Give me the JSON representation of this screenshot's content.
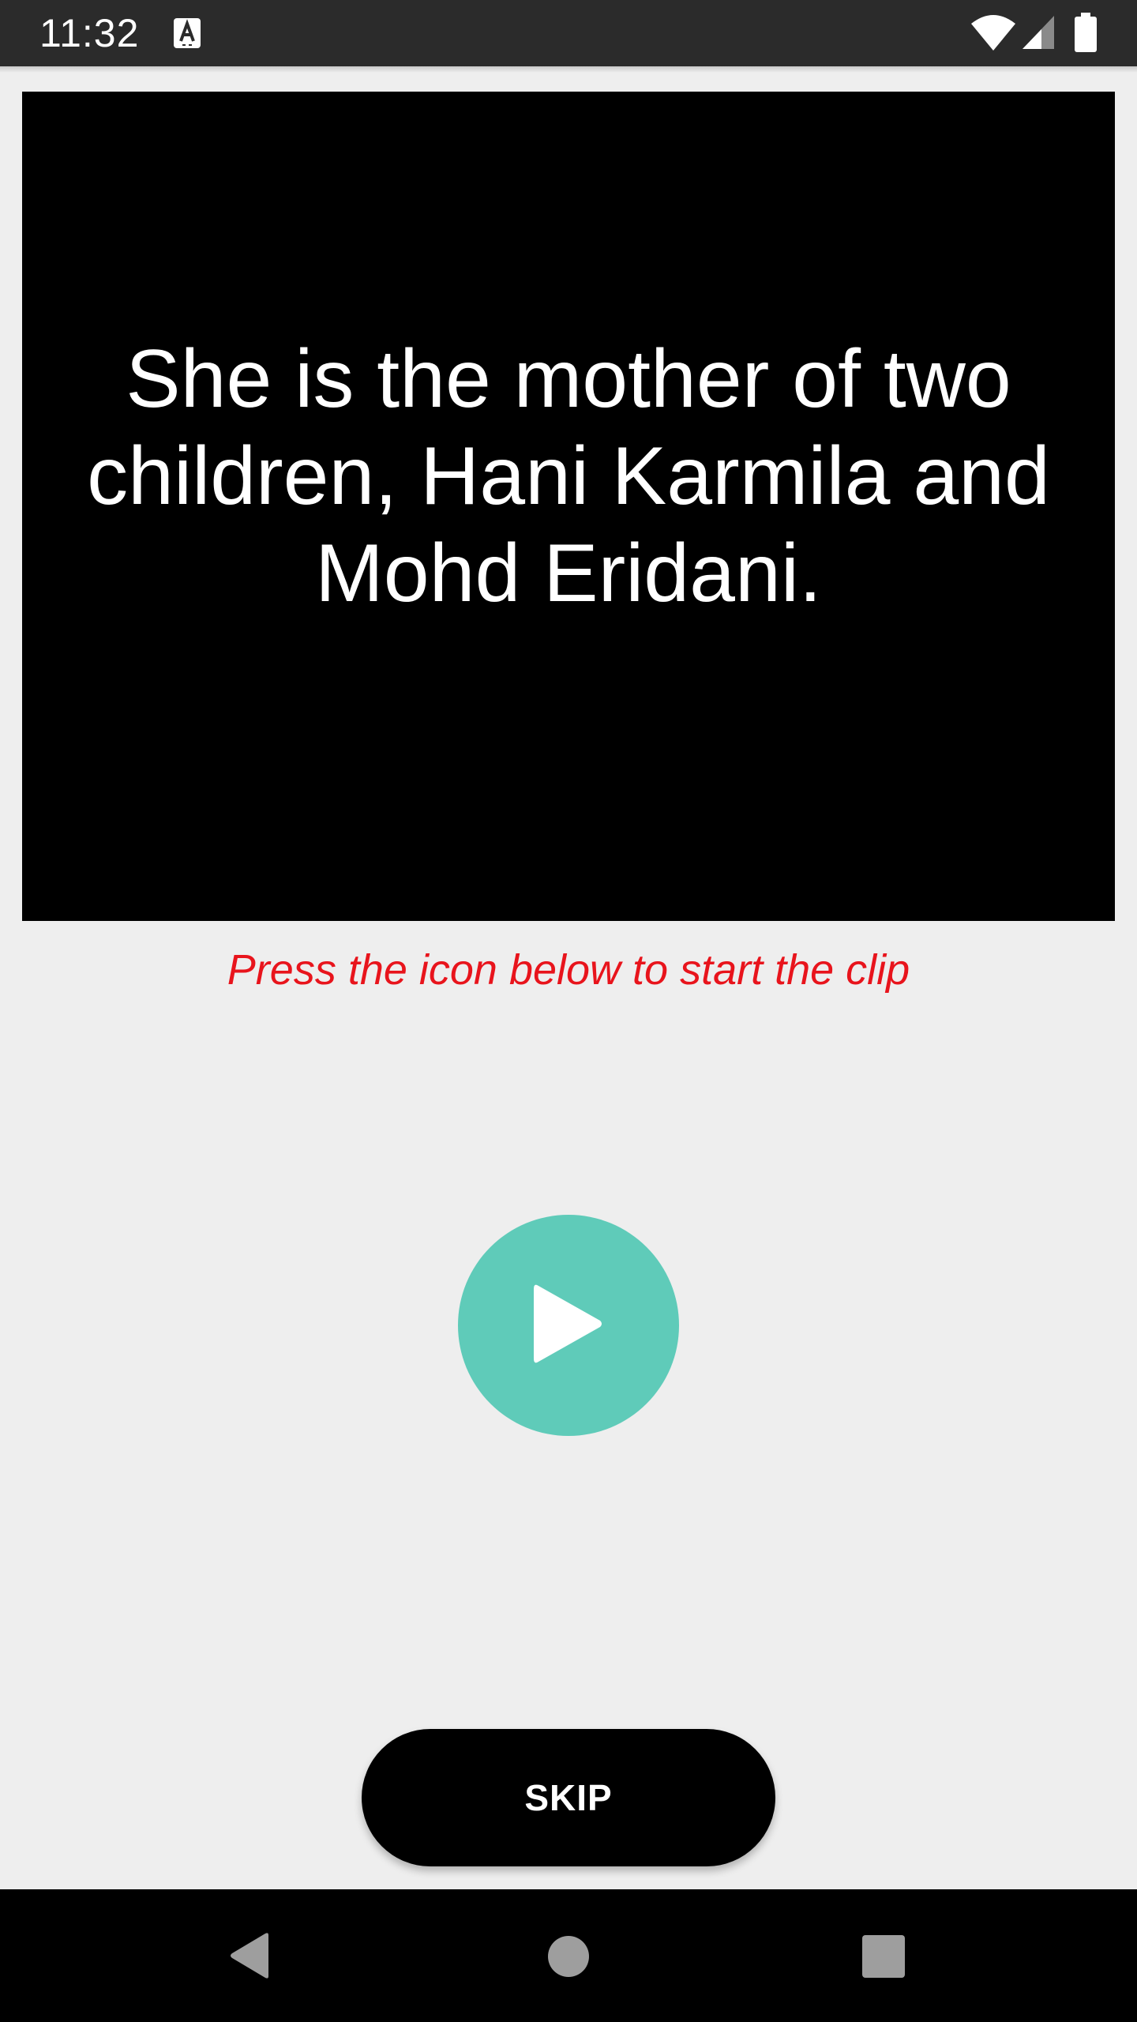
{
  "status_bar": {
    "time": "11:32",
    "icons": [
      "text-a-icon",
      "wifi-icon",
      "signal-icon",
      "battery-icon"
    ]
  },
  "video": {
    "sentence": "She is the mother of two children, Hani Karmila and Mohd Eridani."
  },
  "instruction": "Press the icon below to start the clip",
  "play_button": {
    "icon": "play-icon",
    "color": "#5fcbb9"
  },
  "skip_button": {
    "label": "SKIP"
  },
  "nav_bar": {
    "icons": [
      "back-icon",
      "home-icon",
      "recents-icon"
    ]
  },
  "colors": {
    "accent": "#5fcbb9",
    "instruction": "#e8141c",
    "background": "#eeeeee"
  }
}
